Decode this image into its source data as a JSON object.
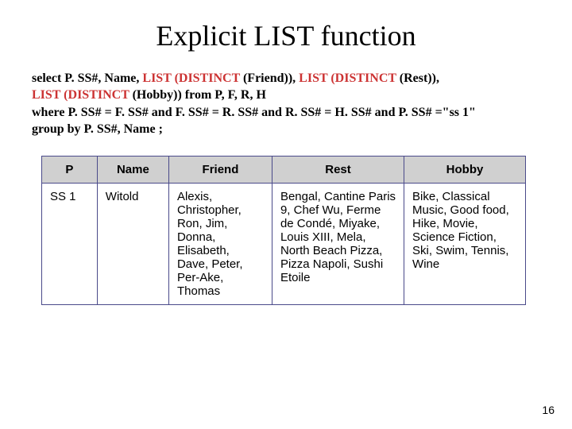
{
  "title": "Explicit LIST function",
  "query": {
    "line1_pre": "select P. SS#, Name, ",
    "line1_hl1": "LIST (DISTINCT",
    "line1_mid1": " (Friend)),  ",
    "line1_hl2": "LIST (DISTINCT",
    "line1_mid2": " (Rest)),",
    "line2_hl": "LIST (DISTINCT",
    "line2_rest": " (Hobby))  from P, F, R, H",
    "line3": "where  P. SS# = F. SS# and F. SS# = R. SS# and R. SS# = H. SS# and P. SS# =\"ss 1\"",
    "line4": "group by P. SS#, Name ;"
  },
  "table": {
    "headers": {
      "p": "P",
      "name": "Name",
      "friend": "Friend",
      "rest": "Rest",
      "hobby": "Hobby"
    },
    "row": {
      "p": "SS 1",
      "name": "Witold",
      "friend": "Alexis, Christopher, Ron, Jim, Donna, Elisabeth, Dave, Peter, Per-Ake, Thomas",
      "rest": "Bengal, Cantine Paris 9, Chef Wu, Ferme de Condé, Miyake, Louis XIII, Mela, North Beach Pizza, Pizza Napoli, Sushi Etoile",
      "hobby": "Bike, Classical Music, Good food, Hike, Movie, Science Fiction, Ski, Swim, Tennis, Wine"
    }
  },
  "page_number": "16"
}
